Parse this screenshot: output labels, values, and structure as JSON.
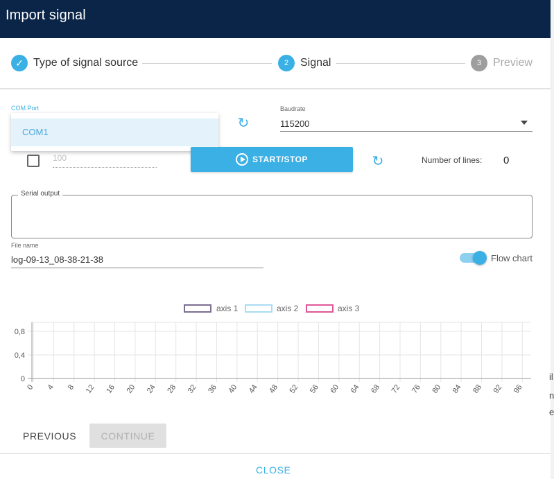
{
  "header": {
    "title": "Import signal"
  },
  "stepper": {
    "steps": [
      {
        "number": "✓",
        "label": "Type of signal source",
        "state": "done"
      },
      {
        "number": "2",
        "label": "Signal",
        "state": "active"
      },
      {
        "number": "3",
        "label": "Preview",
        "state": "pending"
      }
    ]
  },
  "com_port": {
    "label": "COM Port",
    "options": [
      "COM1"
    ]
  },
  "baudrate": {
    "label": "Baudrate",
    "value": "115200"
  },
  "lines_input": {
    "placeholder": "100"
  },
  "start_stop": {
    "label": "START/STOP"
  },
  "number_of_lines": {
    "label": "Number of lines:",
    "value": "0"
  },
  "serial_output": {
    "label": "Serial output",
    "value": ""
  },
  "file_name": {
    "label": "File name",
    "value": "log-09-13_08-38-21-38"
  },
  "flow_chart": {
    "label": "Flow chart",
    "enabled": true
  },
  "chart_data": {
    "type": "line",
    "series": [
      {
        "name": "axis 1",
        "color": "#7b6f8f",
        "values": []
      },
      {
        "name": "axis 2",
        "color": "#a9dcf2",
        "values": []
      },
      {
        "name": "axis 3",
        "color": "#e0569a",
        "values": []
      }
    ],
    "x_ticks": [
      "0",
      "4",
      "8",
      "12",
      "16",
      "20",
      "24",
      "28",
      "32",
      "36",
      "40",
      "44",
      "48",
      "52",
      "56",
      "60",
      "64",
      "68",
      "72",
      "76",
      "80",
      "84",
      "88",
      "92",
      "96"
    ],
    "y_ticks": [
      "0",
      "0,4",
      "0,8"
    ],
    "ylim": [
      0,
      0.8
    ],
    "grid": true,
    "legend": "top-center"
  },
  "actions": {
    "previous": "PREVIOUS",
    "continue": "CONTINUE",
    "close": "CLOSE"
  },
  "colors": {
    "header": "#0b2548",
    "accent": "#3ab0e5"
  },
  "background_fragments": [
    "il",
    "n",
    "e"
  ]
}
